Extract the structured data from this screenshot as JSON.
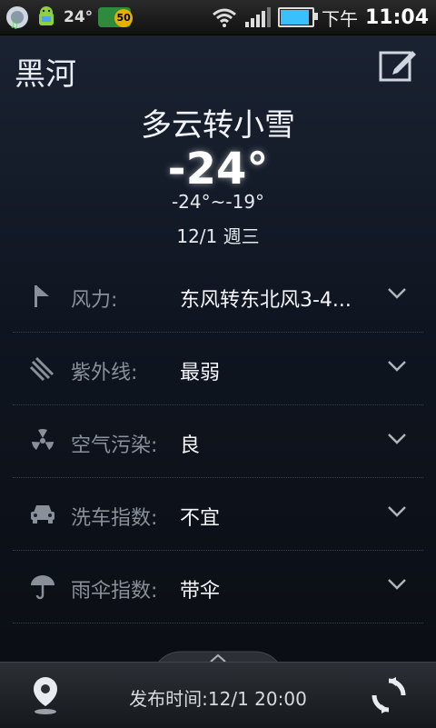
{
  "status_bar": {
    "temp": "24°",
    "badge_count": "50",
    "ampm": "下午",
    "time": "11:04",
    "battery_level": 0.9,
    "signal_level": 0.8
  },
  "header": {
    "city": "黑河",
    "edit_icon": "edit-icon"
  },
  "weather": {
    "condition": "多云转小雪",
    "temperature": "-24°",
    "range": "-24°~-19°",
    "date": "12/1 週三"
  },
  "details": [
    {
      "icon": "wind-flag-icon",
      "label": "风力:",
      "value": "东风转东北风3-4..."
    },
    {
      "icon": "uv-rays-icon",
      "label": "紫外线:",
      "value": "最弱"
    },
    {
      "icon": "radiation-icon",
      "label": "空气污染:",
      "value": "良"
    },
    {
      "icon": "car-icon",
      "label": "洗车指数:",
      "value": "不宜"
    },
    {
      "icon": "umbrella-icon",
      "label": "雨伞指数:",
      "value": "带伞"
    }
  ],
  "footer": {
    "publish_time": "发布时间:12/1 20:00",
    "location_icon": "location-pin-icon",
    "refresh_icon": "refresh-icon"
  },
  "colors": {
    "accent_blue": "#39c0ff",
    "label_gray": "#8a9099",
    "badge_green": "#2e8b3d"
  }
}
